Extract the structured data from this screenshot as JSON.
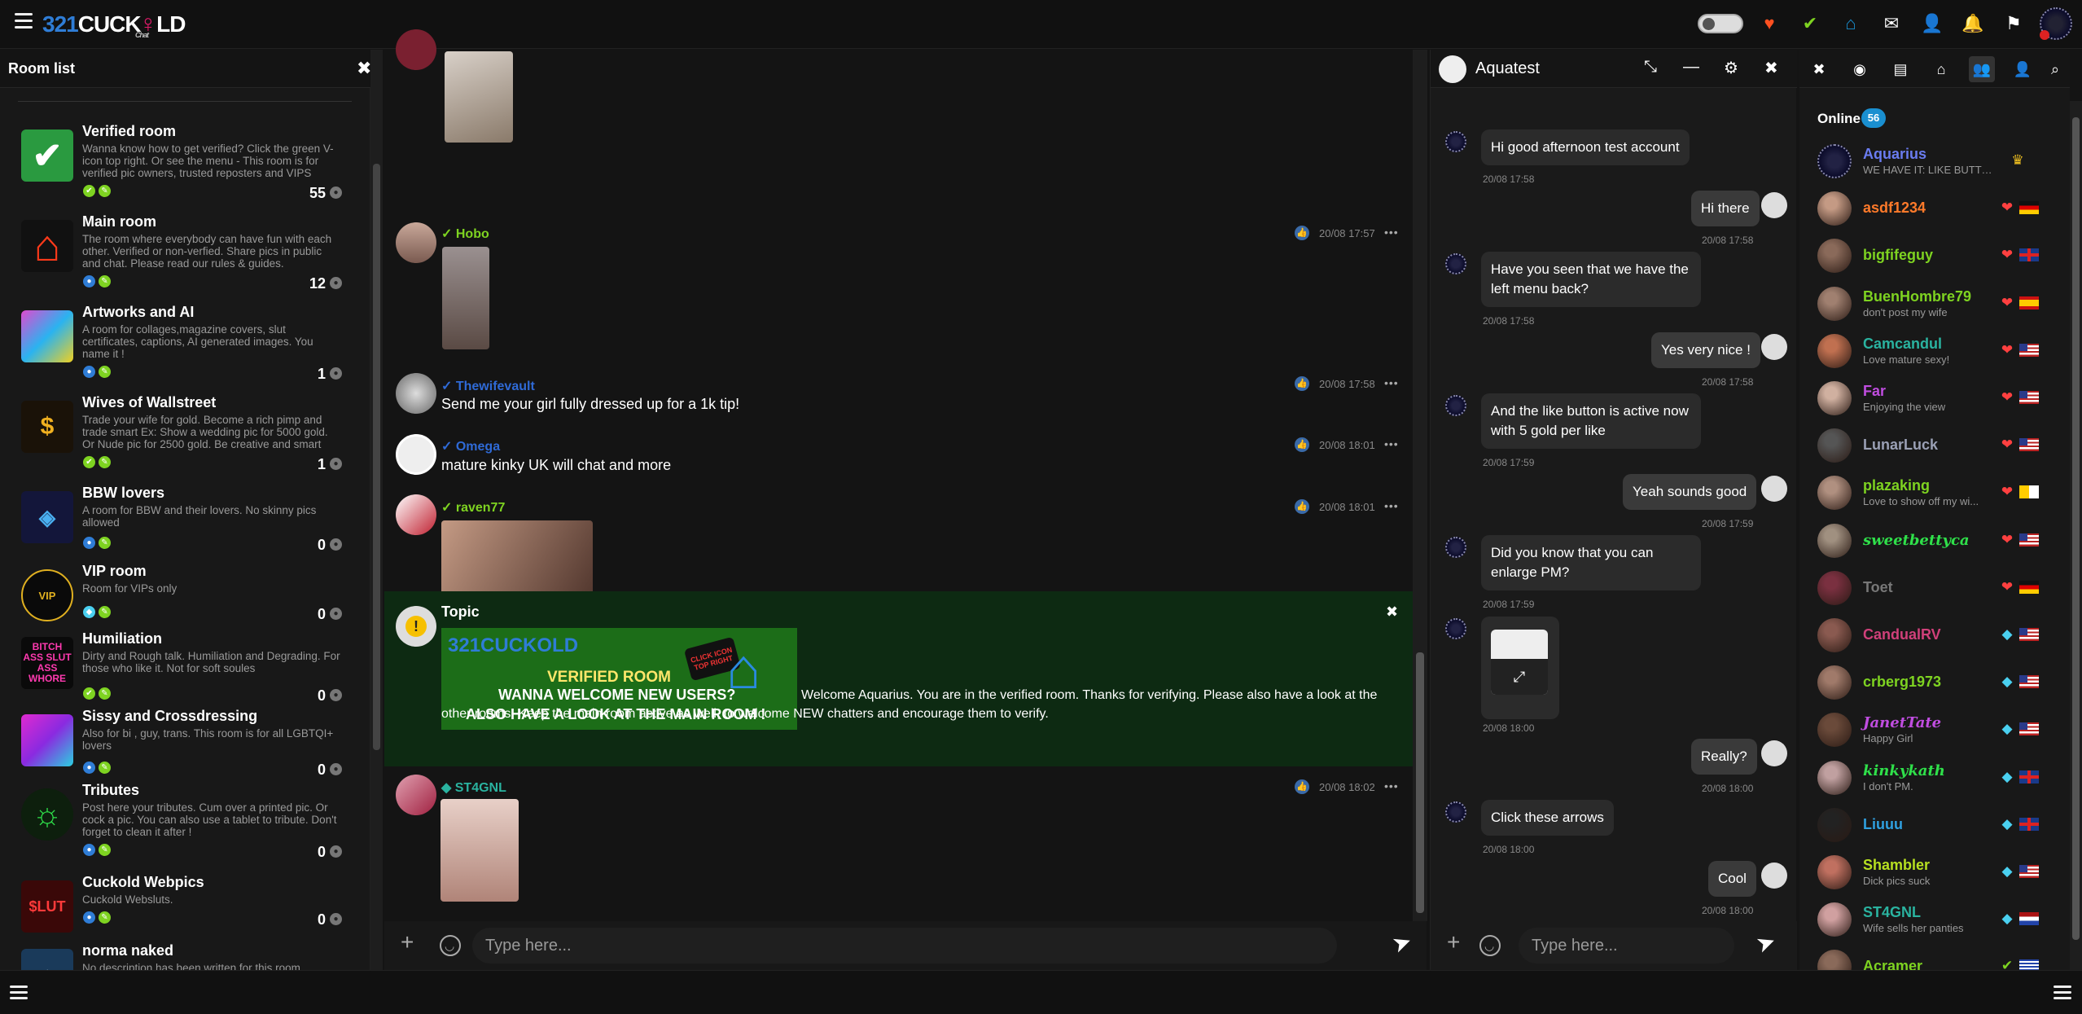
{
  "app": {
    "logo_num": "321",
    "logo_word": "CUCK",
    "logo_tail": "LD",
    "logo_sub": "Chat"
  },
  "colors": {
    "accent": "#1a8fd0",
    "verified": "#7ed321",
    "topic_bg": "#0d2a12",
    "danger": "#e33"
  },
  "topbar_icons": [
    "heart-icon",
    "check-icon",
    "home-icon",
    "mail-icon",
    "add-user-icon",
    "bell-icon",
    "flag-icon"
  ],
  "roomlist": {
    "title": "Room list",
    "rooms": [
      {
        "name": "Verified room",
        "desc": "Wanna know how to get verified? Click the green V-icon top right. Or see the menu - This room is for verified pic owners, trusted reposters and VIPS",
        "count": "55"
      },
      {
        "name": "Main room",
        "desc": "The room where everybody can have fun with each other. Verified or non-verfied. Share pics in public and chat. Please read our rules & guides.",
        "count": "12"
      },
      {
        "name": "Artworks and AI",
        "desc": "A room for collages,magazine covers, slut certificates, captions, AI generated images. You name it !",
        "count": "1"
      },
      {
        "name": "Wives of Wallstreet",
        "desc": "Trade your wife for gold. Become a rich pimp and trade smart Ex: Show a wedding pic for 5000 gold. Or Nude pic for 2500 gold. Be creative and smart",
        "count": "1"
      },
      {
        "name": "BBW lovers",
        "desc": "A room for BBW and their lovers. No skinny pics allowed",
        "count": "0"
      },
      {
        "name": "VIP room",
        "desc": "Room for VIPs only",
        "count": "0"
      },
      {
        "name": "Humiliation",
        "desc": "Dirty and Rough talk. Humiliation and Degrading. For those who like it. Not for soft soules",
        "count": "0"
      },
      {
        "name": "Sissy and Crossdressing",
        "desc": "Also for bi , guy, trans. This room is for all LGBTQI+ lovers",
        "count": "0"
      },
      {
        "name": "Tributes",
        "desc": "Post here your tributes. Cum over a printed pic. Or cock a pic. You can also use a tablet to tribute. Don't forget to clean it after !",
        "count": "0"
      },
      {
        "name": "Cuckold Webpics",
        "desc": "Cuckold Websluts.",
        "count": "0"
      },
      {
        "name": "norma naked",
        "desc": "No description has been written for this room",
        "count": ""
      }
    ],
    "icon_labels": {
      "humiliation": "BITCH ASS SLUT ASS WHORE",
      "vip": "VIP",
      "webpics": "$LUT"
    }
  },
  "main": {
    "messages": [
      {
        "user": "Hobo",
        "time": "20/08 17:57",
        "text": ""
      },
      {
        "user": "Thewifevault",
        "time": "20/08 17:58",
        "text": "Send me your girl fully dressed up for a 1k tip!"
      },
      {
        "user": "Omega",
        "time": "20/08 18:01",
        "text": "mature kinky UK will chat and more"
      },
      {
        "user": "raven77",
        "time": "20/08 18:01",
        "text": ""
      },
      {
        "user": "ST4GNL",
        "time": "20/08 18:02",
        "text": ""
      }
    ],
    "topic": {
      "title": "Topic",
      "banner_logo": "321CUCKOLD",
      "banner_line1": "VERIFIED ROOM",
      "banner_line2": "WANNA WELCOME NEW USERS?",
      "banner_line3": "ALSO HAVE A LOOK AT THE MAIN ROOM !",
      "banner_tag": "CLICK ICON TOP RIGHT",
      "text": "Welcome Aquarius. You are in the verified room. Thanks for verifying. Please also have a look at the other rooms. Keep the main room active as well, to welcome NEW chatters and encourage them to verify."
    },
    "input_placeholder": "Type here..."
  },
  "pm": {
    "title": "Aquatest",
    "messages": [
      {
        "dir": "in",
        "text": "Hi good afternoon test account",
        "time": "20/08 17:58"
      },
      {
        "dir": "out",
        "text": "Hi there",
        "time": "20/08 17:58"
      },
      {
        "dir": "in",
        "text": "Have you seen that we have the left menu back?",
        "time": "20/08 17:58"
      },
      {
        "dir": "out",
        "text": "Yes very nice !",
        "time": "20/08 17:58"
      },
      {
        "dir": "in",
        "text": "And the like button is active now with 5 gold per like",
        "time": "20/08 17:59"
      },
      {
        "dir": "out",
        "text": "Yeah sounds good",
        "time": "20/08 17:59"
      },
      {
        "dir": "in",
        "text": "Did you know that you can enlarge PM?",
        "time": "20/08 17:59"
      },
      {
        "dir": "in",
        "text": "",
        "time": "20/08 18:00"
      },
      {
        "dir": "out",
        "text": "Really?",
        "time": "20/08 18:00"
      },
      {
        "dir": "in",
        "text": "Click these arrows",
        "time": "20/08 18:00"
      },
      {
        "dir": "out",
        "text": "Cool",
        "time": "20/08 18:00"
      }
    ],
    "input_placeholder": "Type here..."
  },
  "users": {
    "online_label": "Online",
    "online_count": "56",
    "list": [
      {
        "name": "Aquarius",
        "status": "WE HAVE IT: LIKE BUTTON",
        "color": "#6a7cf0",
        "icon": "crown-icon",
        "flag": ""
      },
      {
        "name": "asdf1234",
        "status": "",
        "color": "#ff7a2a",
        "icon": "hearts-icon",
        "flag": "de"
      },
      {
        "name": "bigfifeguy",
        "status": "",
        "color": "#7ed321",
        "icon": "hearts-icon",
        "flag": "uk"
      },
      {
        "name": "BuenHombre79",
        "status": "don't post my wife",
        "color": "#7ed321",
        "icon": "hearts-icon",
        "flag": "es"
      },
      {
        "name": "Camcandul",
        "status": "Love mature sexy!",
        "color": "#2ab3a0",
        "icon": "hearts-icon",
        "flag": "us"
      },
      {
        "name": "Far",
        "status": "Enjoying the view",
        "color": "#c04de0",
        "icon": "hearts-icon",
        "flag": "us"
      },
      {
        "name": "LunarLuck",
        "status": "",
        "color": "#9aa0b5",
        "icon": "hearts-icon",
        "flag": "us"
      },
      {
        "name": "plazaking",
        "status": "Love to show off my wi...",
        "color": "#7ed321",
        "icon": "hearts-icon",
        "flag": "va"
      },
      {
        "name": "sweetbettyca",
        "status": "",
        "color": "#2fe04a",
        "icon": "hearts-icon",
        "flag": "us"
      },
      {
        "name": "Toet",
        "status": "",
        "color": "#777",
        "icon": "hearts-icon",
        "flag": "de"
      },
      {
        "name": "CandualRV",
        "status": "",
        "color": "#d0407a",
        "icon": "diamond-icon",
        "flag": "us"
      },
      {
        "name": "crberg1973",
        "status": "",
        "color": "#7ed321",
        "icon": "diamond-icon",
        "flag": "us"
      },
      {
        "name": "JanetTate",
        "status": "Happy Girl",
        "color": "#c04de0",
        "icon": "diamond-icon",
        "flag": "us"
      },
      {
        "name": "kinkykath",
        "status": "I don't PM.",
        "color": "#2fe04a",
        "icon": "diamond-icon",
        "flag": "uk"
      },
      {
        "name": "Liuuu",
        "status": "",
        "color": "#2fa0e0",
        "icon": "diamond-icon",
        "flag": "uk"
      },
      {
        "name": "Shambler",
        "status": "Dick pics suck",
        "color": "#b7e021",
        "icon": "diamond-icon",
        "flag": "us"
      },
      {
        "name": "ST4GNL",
        "status": "Wife sells her panties",
        "color": "#2ab3a0",
        "icon": "diamond-icon",
        "flag": "nl"
      },
      {
        "name": "Acramer",
        "status": "",
        "color": "#7ed321",
        "icon": "check-icon",
        "flag": "gr"
      }
    ]
  }
}
